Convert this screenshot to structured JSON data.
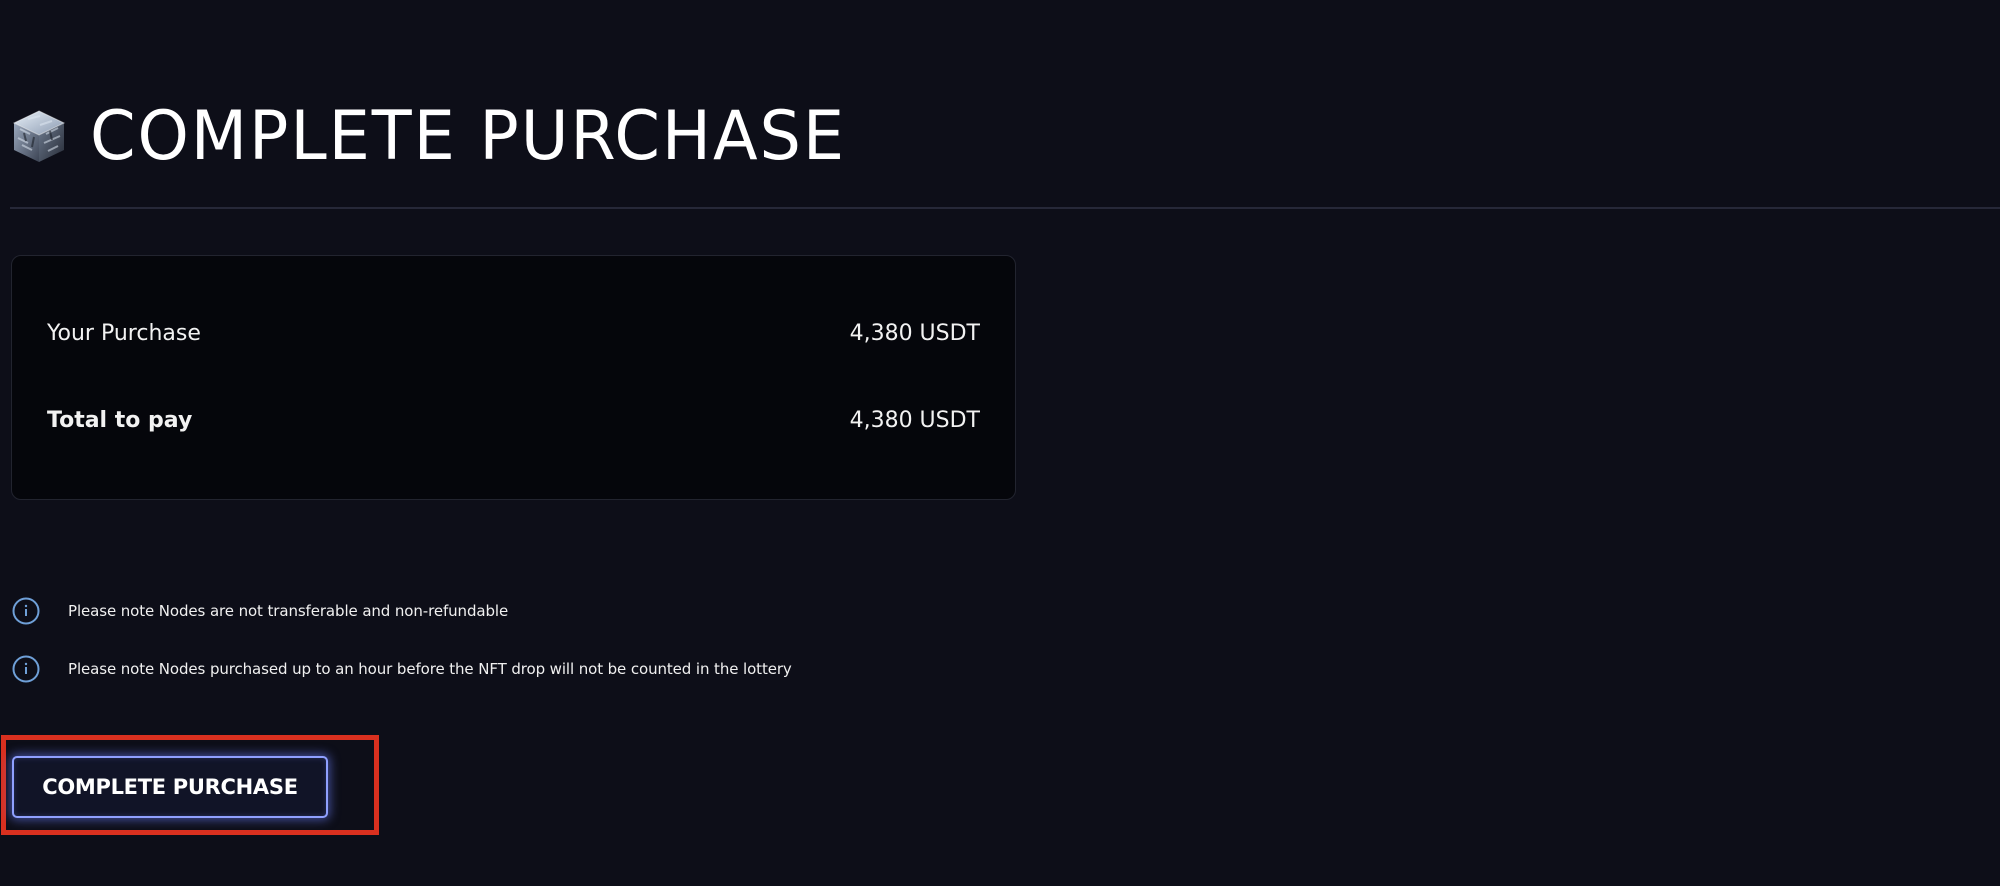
{
  "header": {
    "title": "COMPLETE PURCHASE",
    "icon": "node-cube-icon"
  },
  "summary": {
    "purchase_label": "Your Purchase",
    "purchase_value": "4,380 USDT",
    "total_label": "Total to pay",
    "total_value": "4,380 USDT"
  },
  "notes": [
    {
      "icon": "info-icon",
      "text": "Please note Nodes are not transferable and non-refundable"
    },
    {
      "icon": "info-icon",
      "text": "Please note Nodes purchased up to an hour before the NFT drop will not be counted in the lottery"
    }
  ],
  "actions": {
    "complete_label": "COMPLETE PURCHASE"
  },
  "colors": {
    "background": "#0d0e18",
    "card": "#05060b",
    "button_glow": "#8fa0ff",
    "highlight": "#d9301f",
    "info_icon": "#6fa0d8"
  }
}
